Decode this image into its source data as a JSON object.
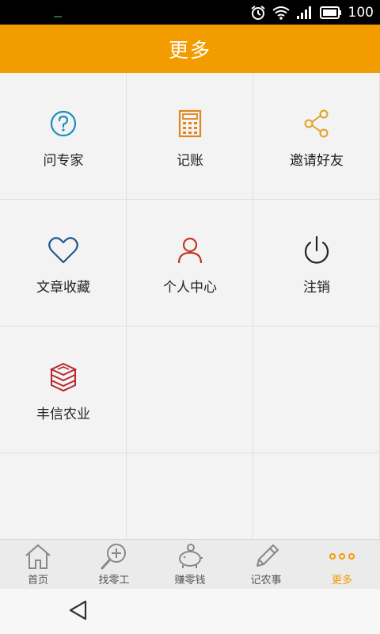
{
  "status_bar": {
    "battery": "100"
  },
  "header": {
    "title": "更多"
  },
  "menu": [
    {
      "label": "问专家",
      "icon": "question-circle-icon",
      "color": "#1a8fbf"
    },
    {
      "label": "记账",
      "icon": "calculator-icon",
      "color": "#e0861c"
    },
    {
      "label": "邀请好友",
      "icon": "share-icon",
      "color": "#e0a21c"
    },
    {
      "label": "文章收藏",
      "icon": "heart-icon",
      "color": "#1f5a8f"
    },
    {
      "label": "个人中心",
      "icon": "person-icon",
      "color": "#c0392b"
    },
    {
      "label": "注销",
      "icon": "power-icon",
      "color": "#222222"
    },
    {
      "label": "丰信农业",
      "icon": "brand-cube-icon",
      "color": "#b7282e"
    }
  ],
  "tabs": [
    {
      "label": "首页",
      "icon": "home-icon"
    },
    {
      "label": "找零工",
      "icon": "search-plus-icon"
    },
    {
      "label": "赚零钱",
      "icon": "piggy-bank-icon"
    },
    {
      "label": "记农事",
      "icon": "pencil-icon"
    },
    {
      "label": "更多",
      "icon": "more-dots-icon",
      "active": true
    }
  ],
  "colors": {
    "accent": "#f29c00"
  }
}
